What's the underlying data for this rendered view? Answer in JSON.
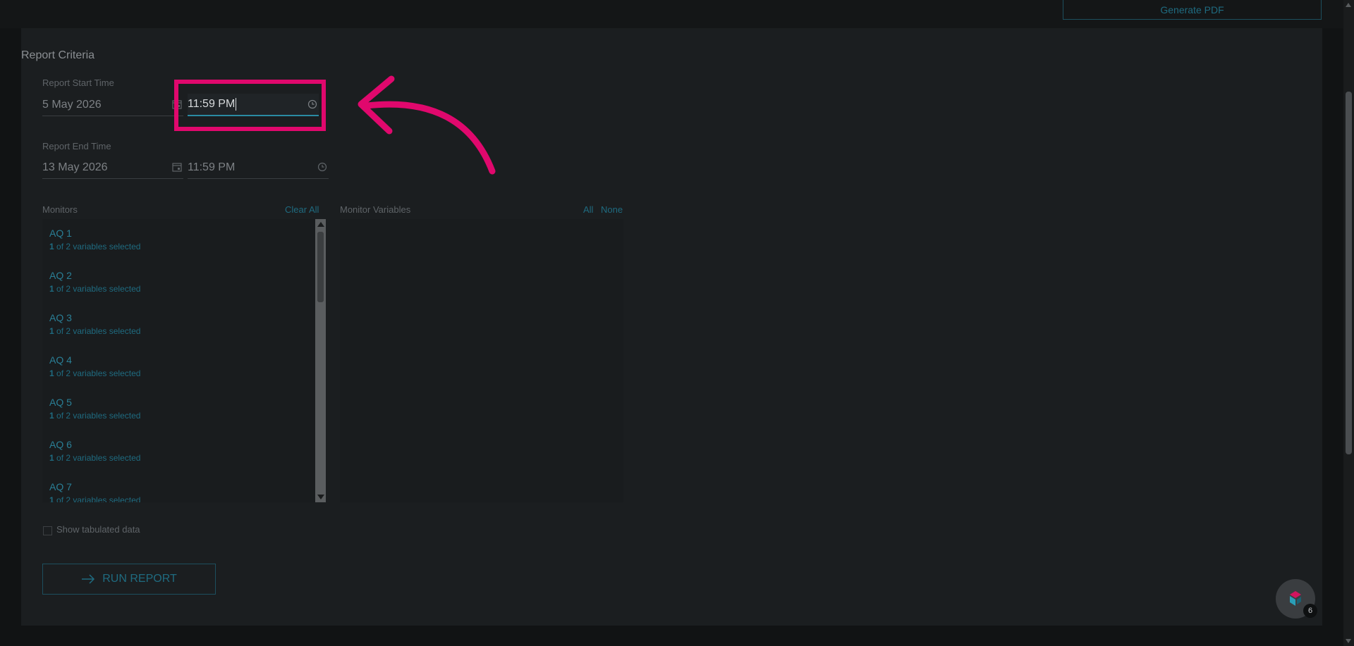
{
  "header": {
    "generate_pdf_label": "Generate PDF"
  },
  "criteria": {
    "title": "Report Criteria",
    "start": {
      "label": "Report Start Time",
      "date": "5 May 2026",
      "time": "11:59 PM"
    },
    "end": {
      "label": "Report End Time",
      "date": "13 May 2026",
      "time": "11:59 PM"
    }
  },
  "monitors": {
    "header": "Monitors",
    "clear_all": "Clear All",
    "items": [
      {
        "name": "AQ 1",
        "count": "1",
        "rest": " of 2 variables selected"
      },
      {
        "name": "AQ 2",
        "count": "1",
        "rest": " of 2 variables selected"
      },
      {
        "name": "AQ 3",
        "count": "1",
        "rest": " of 2 variables selected"
      },
      {
        "name": "AQ 4",
        "count": "1",
        "rest": " of 2 variables selected"
      },
      {
        "name": "AQ 5",
        "count": "1",
        "rest": " of 2 variables selected"
      },
      {
        "name": "AQ 6",
        "count": "1",
        "rest": " of 2 variables selected"
      },
      {
        "name": "AQ 7",
        "count": "1",
        "rest": " of 2 variables selected"
      }
    ]
  },
  "variables": {
    "header": "Monitor Variables",
    "all": "All",
    "none": "None"
  },
  "options": {
    "show_tabulated": "Show tabulated data"
  },
  "run_report_label": "RUN REPORT",
  "help_badge": "6",
  "colors": {
    "highlight": "#e0086d",
    "accent": "#1f6b80",
    "panel": "#1b1e20"
  }
}
